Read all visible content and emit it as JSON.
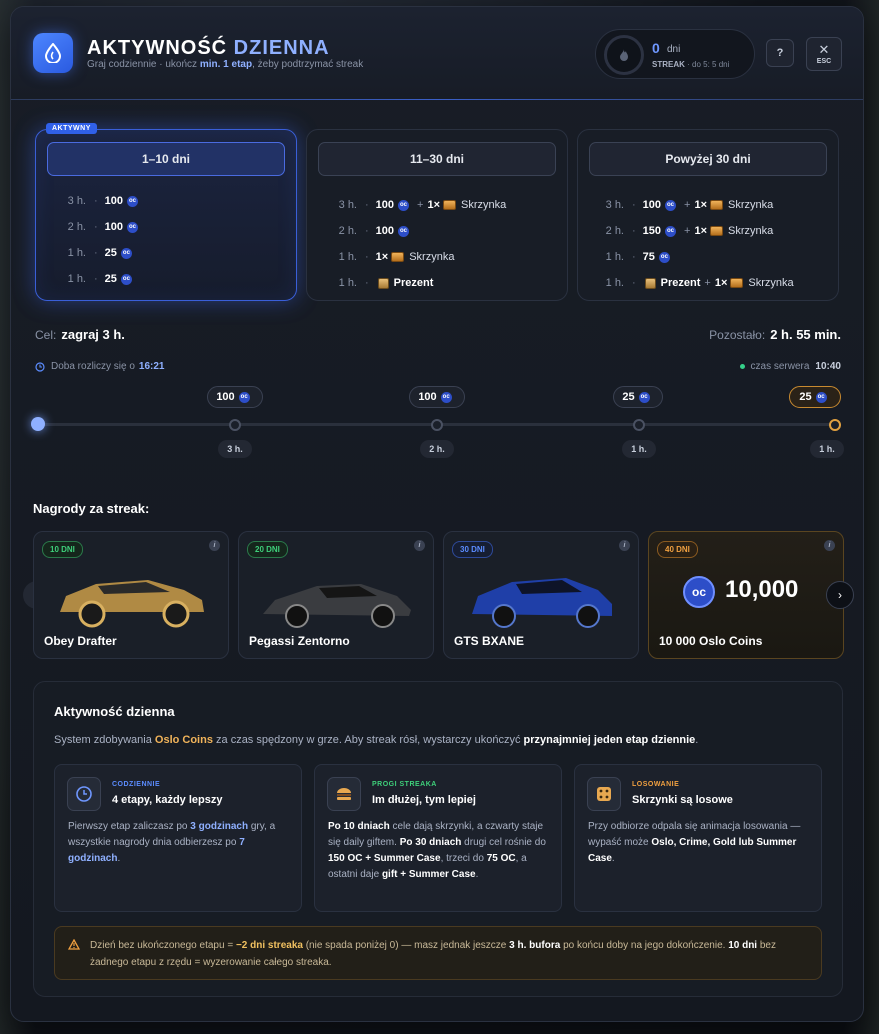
{
  "header": {
    "title_a": "AKTYWNOŚĆ",
    "title_b": "DZIENNA",
    "subtitle_a": "Graj codziennie · ukończ",
    "subtitle_b": "min. 1 etap",
    "subtitle_c": ", żeby podtrzymać streak",
    "streak_value": "0",
    "streak_unit": "dni",
    "streak_label": "STREAK",
    "streak_to": "· do 5: 5 dni",
    "help_label": "?",
    "close_label": "✕",
    "esc_label": "ESC"
  },
  "tiers": [
    {
      "title": "1–10 dni",
      "badge": "AKTYWNY",
      "rows": [
        {
          "dur": "3 h.",
          "amt": "100",
          "extra": ""
        },
        {
          "dur": "2 h.",
          "amt": "100",
          "extra": ""
        },
        {
          "dur": "1 h.",
          "amt": "25",
          "extra": ""
        },
        {
          "dur": "1 h.",
          "amt": "25",
          "extra": ""
        }
      ]
    },
    {
      "title": "11–30 dni",
      "rows": [
        {
          "dur": "3 h.",
          "amt": "100",
          "mult": "1×",
          "item": "Skrzynka"
        },
        {
          "dur": "2 h.",
          "amt": "100"
        },
        {
          "dur": "1 h.",
          "mult": "1×",
          "item": "Skrzynka"
        },
        {
          "dur": "1 h.",
          "gift": "Prezent"
        }
      ]
    },
    {
      "title": "Powyżej 30 dni",
      "rows": [
        {
          "dur": "3 h.",
          "amt": "100",
          "mult": "1×",
          "item": "Skrzynka"
        },
        {
          "dur": "2 h.",
          "amt": "150",
          "mult": "1×",
          "item": "Skrzynka"
        },
        {
          "dur": "1 h.",
          "amt": "75"
        },
        {
          "dur": "1 h.",
          "gift": "Prezent",
          "mult": "1×",
          "item": "Skrzynka"
        }
      ]
    }
  ],
  "progress": {
    "goal_label": "Cel:",
    "goal_value": "zagraj 3 h.",
    "remain_label": "Pozostało:",
    "remain_value": "2 h. 55 min.",
    "reset_label": "Doba rozliczy się o",
    "reset_time": "16:21",
    "server_label": "czas serwera",
    "server_time": "10:40",
    "milestones": [
      {
        "reward": "100",
        "dur": "3 h."
      },
      {
        "reward": "100",
        "dur": "2 h."
      },
      {
        "reward": "25",
        "dur": "1 h."
      },
      {
        "reward": "25",
        "dur": "1 h."
      }
    ]
  },
  "streak_rewards": {
    "title": "Nagrody za streak:",
    "cards": [
      {
        "tag": "10 DNI",
        "name": "Obey Drafter",
        "color": "#3ecf7a"
      },
      {
        "tag": "20 DNI",
        "name": "Pegassi Zentorno",
        "color": "#3ecf7a"
      },
      {
        "tag": "30 DNI",
        "name": "GTS BXANE",
        "color": "#5b8cff"
      },
      {
        "tag": "40 DNI",
        "name": "10 000 Oslo Coins",
        "amount": "10,000",
        "color": "#f0a040"
      }
    ],
    "info_icon": "i"
  },
  "info": {
    "title": "Aktywność dzienna",
    "desc_a": "System zdobywania",
    "desc_coins": "Oslo Coins",
    "desc_b": "za czas spędzony w grze. Aby streak rósł, wystarczy ukończyć",
    "desc_bold": "przynajmniej jeden etap dziennie",
    "desc_c": ".",
    "features": [
      {
        "cat": "CODZIENNIE",
        "cat_color": "#5b8cff",
        "head": "4 etapy, każdy lepszy",
        "p1": "Pierwszy etap zaliczasz po",
        "h1": "3 godzinach",
        "p2": "gry, a wszystkie nagrody dnia odbierzesz po",
        "h2": "7 godzinach",
        "p3": "."
      },
      {
        "cat": "PROGI STREAKA",
        "cat_color": "#3ecf7a",
        "head": "Im dłużej, tym lepiej",
        "b1": "Po 10 dniach",
        "t1": "cele dają skrzynki, a czwarty staje się daily giftem.",
        "b2": "Po 30 dniach",
        "t2": "drugi cel rośnie do",
        "b3": "150 OC + Summer Case",
        "t3": ", trzeci do",
        "b4": "75 OC",
        "t4": ", a ostatni daje",
        "b5": "gift + Summer Case",
        "t5": "."
      },
      {
        "cat": "LOSOWANIE",
        "cat_color": "#f0a040",
        "head": "Skrzynki są losowe",
        "t1": "Przy odbiorze odpala się animacja losowania — wypaść może",
        "b1": "Oslo, Crime, Gold lub Summer Case",
        "t2": "."
      }
    ],
    "warn": {
      "a": "Dzień bez ukończonego etapu =",
      "b1": "−2 dni streaka",
      "c": "(nie spada poniżej 0) — masz jednak jeszcze",
      "b2": "3 h. bufora",
      "d": "po końcu doby na jego dokończenie.",
      "b3": "10 dni",
      "e": "bez żadnego etapu z rzędu = wyzerowanie całego streaka."
    }
  }
}
